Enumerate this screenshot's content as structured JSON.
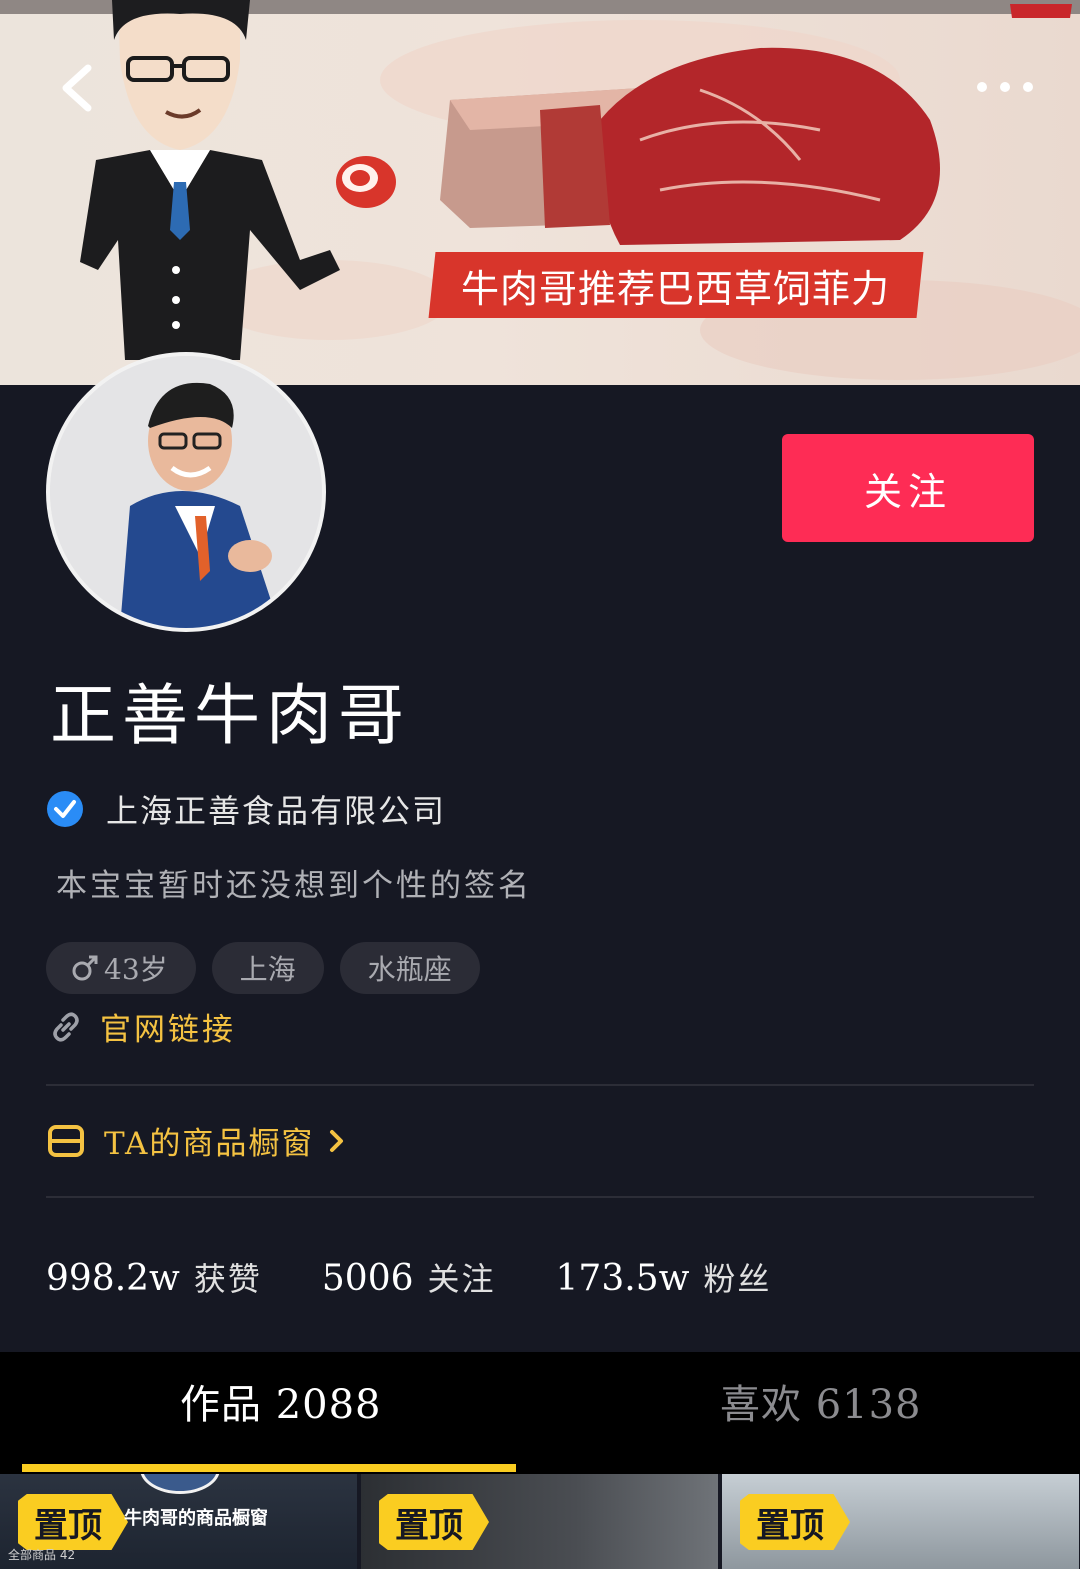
{
  "banner": {
    "tagline": "牛肉哥推荐巴西草饲菲力",
    "colors": {
      "tag_bg": "#d8352b",
      "beef": "#b3262a"
    }
  },
  "profile": {
    "name": "正善牛肉哥",
    "verified_company": "上海正善食品有限公司",
    "signature": "本宝宝暂时还没想到个性的签名",
    "tags": {
      "age": "43岁",
      "city": "上海",
      "zodiac": "水瓶座"
    },
    "website_link": "官网链接",
    "shop_window": "TA的商品橱窗"
  },
  "actions": {
    "follow": "关注"
  },
  "stats": [
    {
      "value": "998.2w",
      "label": "获赞"
    },
    {
      "value": "5006",
      "label": "关注"
    },
    {
      "value": "173.5w",
      "label": "粉丝"
    }
  ],
  "tabs": {
    "works": "作品 2088",
    "likes": "喜欢 6138"
  },
  "grid": {
    "pin_label": "置顶",
    "cell1_title": "牛肉哥的商品橱窗",
    "cell1_sub": "全部商品 42"
  },
  "icons": [
    "back-icon",
    "more-icon",
    "verified-icon",
    "male-icon",
    "link-icon",
    "shop-icon",
    "chevron-right-icon"
  ],
  "theme": {
    "bg": "#161823",
    "accent": "#fe2c55",
    "gold": "#f4c242",
    "tab_underline": "#facd21"
  }
}
